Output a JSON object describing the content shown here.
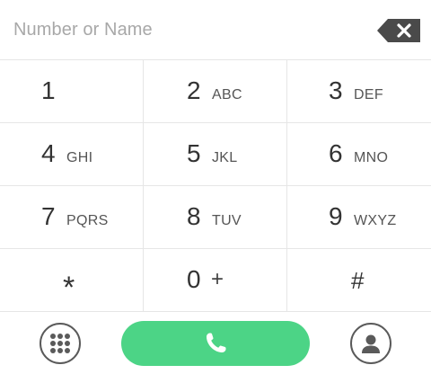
{
  "entry": {
    "placeholder": "Number or Name"
  },
  "keypad": [
    {
      "digit": "1",
      "letters": ""
    },
    {
      "digit": "2",
      "letters": "ABC"
    },
    {
      "digit": "3",
      "letters": "DEF"
    },
    {
      "digit": "4",
      "letters": "GHI"
    },
    {
      "digit": "5",
      "letters": "JKL"
    },
    {
      "digit": "6",
      "letters": "MNO"
    },
    {
      "digit": "7",
      "letters": "PQRS"
    },
    {
      "digit": "8",
      "letters": "TUV"
    },
    {
      "digit": "9",
      "letters": "WXYZ"
    },
    {
      "digit": "*",
      "letters": ""
    },
    {
      "digit": "0",
      "letters": "+"
    },
    {
      "digit": "#",
      "letters": ""
    }
  ],
  "icons": {
    "backspace": "backspace-icon",
    "dialpad": "dialpad-grid-icon",
    "call": "phone-icon",
    "contacts": "person-icon"
  },
  "colors": {
    "call_button": "#4cd486",
    "backspace": "#4a4a4a",
    "divider": "#e6e6e6",
    "placeholder": "#a8a8a8"
  }
}
